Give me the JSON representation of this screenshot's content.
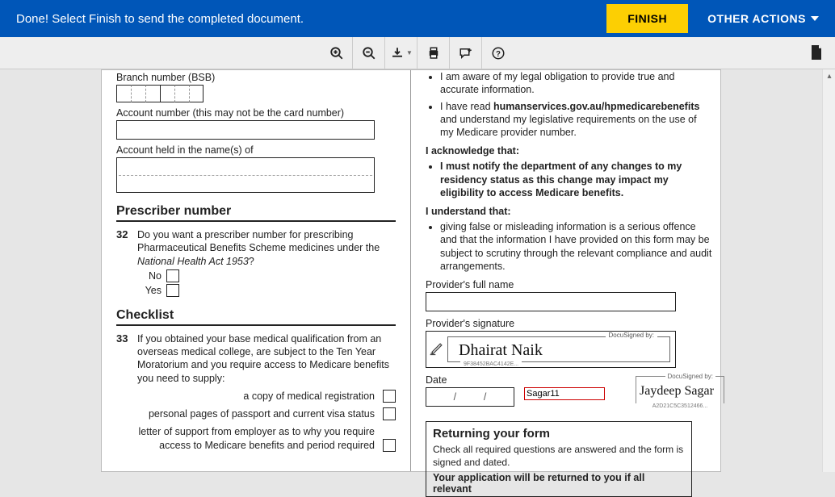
{
  "topbar": {
    "message": "Done! Select Finish to send the completed document.",
    "finish_label": "FINISH",
    "other_actions_label": "OTHER ACTIONS"
  },
  "left_col": {
    "branch_label": "Branch number (BSB)",
    "account_number_label": "Account number (this may not be the card number)",
    "account_held_label": "Account held in the name(s) of",
    "prescriber_section": "Prescriber number",
    "q32_num": "32",
    "q32_text_a": "Do you want a prescriber number for prescribing Pharmaceutical Benefits Scheme medicines under the ",
    "q32_text_b": "National Health Act 1953",
    "q32_text_c": "?",
    "no_label": "No",
    "yes_label": "Yes",
    "checklist_section": "Checklist",
    "q33_num": "33",
    "q33_text": "If you obtained your base medical qualification from an overseas medical college, are subject to the Ten Year Moratorium and you require access to Medicare benefits you need to supply:",
    "chk_a": "a copy of medical registration",
    "chk_b": "personal pages of passport and current visa status",
    "chk_c": "letter of support from employer as to why you require access to Medicare benefits and period required"
  },
  "right_col": {
    "bul_a": "I am aware of my legal obligation to provide true and accurate information.",
    "bul_b_pre": "I have read ",
    "bul_b_link": "humanservices.gov.au/hpmedicarebenefits",
    "bul_b_post": " and understand my legislative requirements on the use of my Medicare provider number.",
    "ack_head": "I acknowledge that:",
    "ack_bul": "I must notify the department of any changes to my residency status as this change may impact my eligibility to access Medicare benefits.",
    "und_head": "I understand that:",
    "und_bul": "giving false or misleading information is a serious offence and that the information I have provided on this form may be subject to scrutiny through the relevant compliance and audit arrangements.",
    "provider_name_label": "Provider's full name",
    "provider_sig_label": "Provider's signature",
    "docusigned_by": "DocuSigned by:",
    "sig_hash": "9F38452BAC4142E...",
    "sig_name": "Dhairat Naik",
    "date_label": "Date",
    "date_slash": "/",
    "red_text": "Sagar11",
    "approver_name": "Jaydeep Sagar",
    "approver_hash": "A2D21C5C3512466...",
    "return_title": "Returning your form",
    "return_text": "Check all required questions are answered and the form is signed and dated.",
    "return_bold": "Your application will be returned to you if all relevant"
  }
}
